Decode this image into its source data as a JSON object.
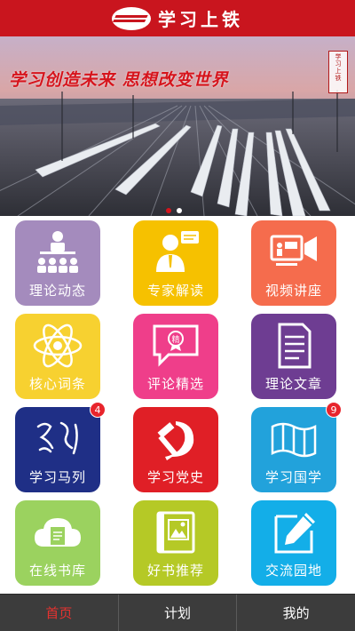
{
  "header": {
    "title": "学习上铁",
    "logo_icon": "railway-logo-icon"
  },
  "banner": {
    "slogan": "学习创造未来 思想改变世界",
    "seal_text": "学习上铁",
    "slides": 2,
    "active_slide": 1
  },
  "grid": {
    "tiles": [
      {
        "label": "理论动态",
        "icon": "lecture-audience-icon",
        "color": "#a48bbd",
        "badge": ""
      },
      {
        "label": "专家解读",
        "icon": "expert-speaker-icon",
        "color": "#f6c100",
        "badge": ""
      },
      {
        "label": "视频讲座",
        "icon": "video-lecture-icon",
        "color": "#f56c4d",
        "badge": ""
      },
      {
        "label": "核心词条",
        "icon": "atom-icon",
        "color": "#f7d130",
        "badge": ""
      },
      {
        "label": "评论精选",
        "icon": "comment-bubble-icon",
        "color": "#ef3e8a",
        "badge": ""
      },
      {
        "label": "理论文章",
        "icon": "document-icon",
        "color": "#6e3d92",
        "badge": ""
      },
      {
        "label": "学习马列",
        "icon": "marx-lenin-portrait-icon",
        "color": "#1f2f86",
        "badge": "4"
      },
      {
        "label": "学习党史",
        "icon": "hammer-sickle-icon",
        "color": "#e01f26",
        "badge": ""
      },
      {
        "label": "学习国学",
        "icon": "scroll-icon",
        "color": "#22a2db",
        "badge": "9"
      },
      {
        "label": "在线书库",
        "icon": "cloud-book-icon",
        "color": "#9bd25f",
        "badge": ""
      },
      {
        "label": "好书推荐",
        "icon": "picture-book-icon",
        "color": "#b5c926",
        "badge": ""
      },
      {
        "label": "交流园地",
        "icon": "edit-pen-icon",
        "color": "#13aee8",
        "badge": ""
      }
    ]
  },
  "tabbar": {
    "tabs": [
      {
        "label": "首页",
        "active": true
      },
      {
        "label": "计划",
        "active": false
      },
      {
        "label": "我的",
        "active": false
      }
    ]
  },
  "colors": {
    "brand_red": "#c9151e",
    "tabbar_bg": "#3c3c3c",
    "active_tab": "#e6322f"
  }
}
